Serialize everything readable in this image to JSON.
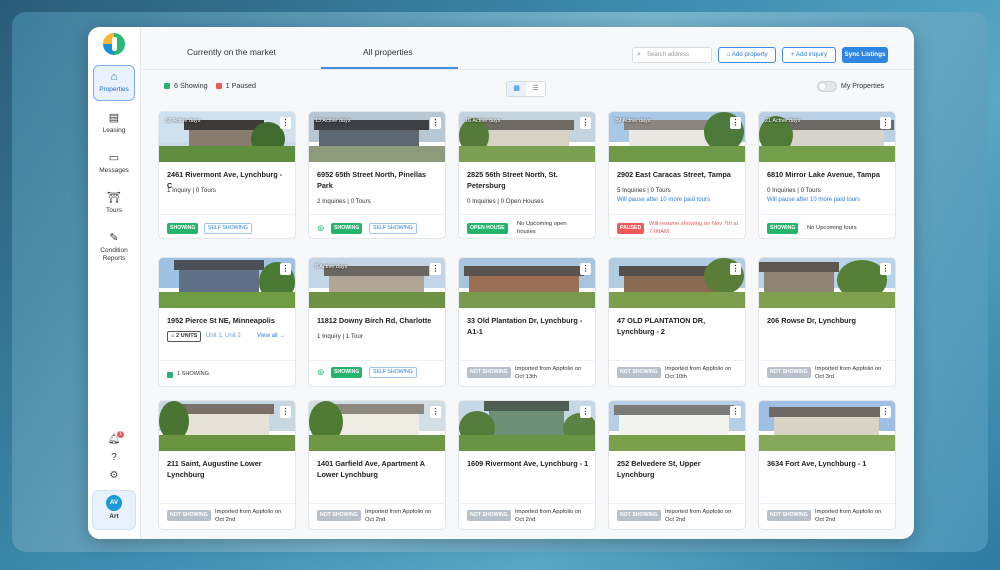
{
  "sidebar": {
    "items": [
      {
        "label": "Properties",
        "icon": "home-icon"
      },
      {
        "label": "Leasing",
        "icon": "leasing-icon"
      },
      {
        "label": "Messages",
        "icon": "message-icon"
      },
      {
        "label": "Tours",
        "icon": "tours-icon"
      },
      {
        "label": "Condition Reports",
        "icon": "report-icon"
      }
    ],
    "notification_count": "1",
    "user": {
      "initials": "AV",
      "name": "Art"
    }
  },
  "tabs": [
    "Currently on the market",
    "All properties"
  ],
  "search": {
    "placeholder": "Search address"
  },
  "actions": {
    "add_property": "Add property",
    "add_inquiry": "+ Add inquiry",
    "sync": "Sync Listings"
  },
  "legend": {
    "showing": "6 Showing",
    "paused": "1 Paused"
  },
  "my_properties": "My Properties",
  "colors": {
    "accent": "#2f86e0",
    "green": "#25b46b",
    "red": "#ee5a5a",
    "grey": "#b8c0ca"
  },
  "cards": [
    {
      "days": "12 Active days",
      "address": "2461 Rivermont Ave, Lynchburg - C",
      "meta": "1 Inquiry | 0 Tours",
      "status": "SHOWING",
      "self": "SELF SHOWING"
    },
    {
      "days": "13 Active days",
      "address": "6952 65th Street North, Pinellas Park",
      "meta": "2 Inquiries | 0 Tours",
      "status": "SHOWING",
      "self": "SELF SHOWING"
    },
    {
      "days": "16 Active days",
      "address": "2825 56th Street North, St. Petersburg",
      "meta": "0 Inquiries | 0 Open Houses",
      "status": "OPEN HOUSE",
      "side": "No Upcoming open houses"
    },
    {
      "days": "39 Active days",
      "address": "2902 East Caracas Street, Tampa",
      "meta": "5 Inquiries | 0 Tours",
      "note": "Will pause after 10 more paid tours",
      "status": "PAUSED",
      "side": "Will resume showing on Nov 7th at 7:00AM"
    },
    {
      "days": "21 Active days",
      "address": "6810 Mirror Lake Avenue, Tampa",
      "meta": "0 Inquiries | 0 Tours",
      "note": "Will pause after 10 more paid tours",
      "status": "SHOWING",
      "side": "No Upcoming tours"
    },
    {
      "address": "1952 Pierce St NE, Minneapolis",
      "units": "2 UNITS",
      "units_list": "Unit 1, Unit 2",
      "view_all": "View all →",
      "status_text": "1 SHOWING"
    },
    {
      "days": "5 Active days",
      "address": "11812 Downy Birch Rd, Charlotte",
      "meta": "1 Inquiry | 1 Tour",
      "status": "SHOWING",
      "self": "SELF SHOWING"
    },
    {
      "address": "33 Old Plantation Dr, Lynchburg - A1-1",
      "status": "NOT SHOWING",
      "side": "Imported from Appfolio on Oct 13th"
    },
    {
      "address": "47 OLD PLANTATION DR, Lynchburg - 2",
      "status": "NOT SHOWING",
      "side": "Imported from Appfolio on Oct 10th"
    },
    {
      "address": "206 Rowse Dr, Lynchburg",
      "status": "NOT SHOWING",
      "side": "Imported from Appfolio on Oct 3rd"
    },
    {
      "address": "211 Saint, Augustine Lower Lynchburg",
      "status": "NOT SHOWING",
      "side": "Imported from Appfolio on Oct 2nd"
    },
    {
      "address": "1401 Garfield Ave, Apartment A Lower Lynchburg",
      "status": "NOT SHOWING",
      "side": "Imported from Appfolio on Oct 2nd"
    },
    {
      "address": "1609 Rivermont Ave, Lynchburg - 1",
      "status": "NOT SHOWING",
      "side": "Imported from Appfolio on Oct 2nd"
    },
    {
      "address": "252 Belvedere St, Upper Lynchburg",
      "status": "NOT SHOWING",
      "side": "Imported from Appfolio on Oct 2nd"
    },
    {
      "address": "3634 Fort Ave, Lynchburg - 1",
      "status": "NOT SHOWING",
      "side": "Imported from Appfolio on Oct 2nd"
    }
  ]
}
